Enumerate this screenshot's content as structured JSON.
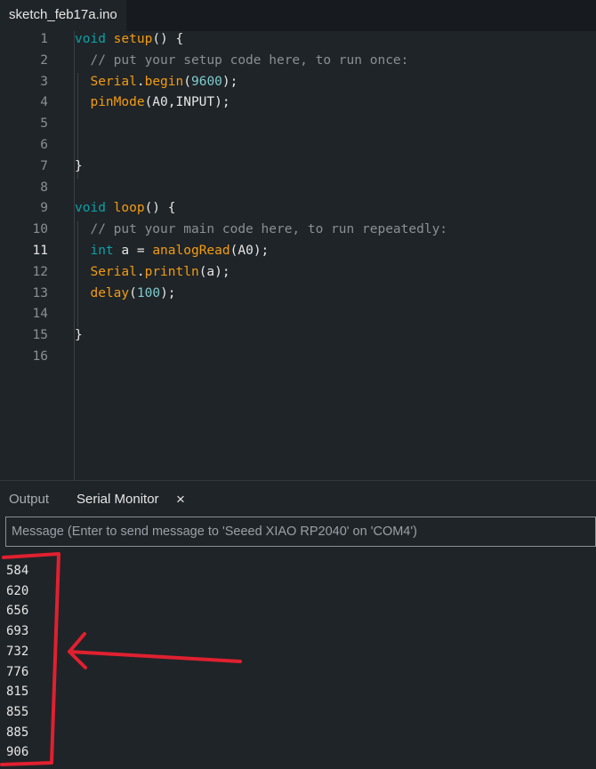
{
  "file_tab": {
    "label": "sketch_feb17a.ino"
  },
  "editor": {
    "line_numbers": [
      "1",
      "2",
      "3",
      "4",
      "5",
      "6",
      "7",
      "8",
      "9",
      "10",
      "11",
      "12",
      "13",
      "14",
      "15",
      "16"
    ],
    "lines": [
      {
        "num": "1",
        "parts": [
          {
            "t": "void",
            "c": "kw"
          },
          {
            "t": " "
          },
          {
            "t": "setup",
            "c": "fn"
          },
          {
            "t": "() {"
          }
        ]
      },
      {
        "num": "2",
        "parts": [
          {
            "t": "  // put your setup code here, to run once:",
            "c": "cm"
          }
        ]
      },
      {
        "num": "3",
        "parts": [
          {
            "t": "  "
          },
          {
            "t": "Serial",
            "c": "fn"
          },
          {
            "t": "."
          },
          {
            "t": "begin",
            "c": "fn"
          },
          {
            "t": "("
          },
          {
            "t": "9600",
            "c": "num"
          },
          {
            "t": ");"
          }
        ]
      },
      {
        "num": "4",
        "parts": [
          {
            "t": "  "
          },
          {
            "t": "pinMode",
            "c": "fn"
          },
          {
            "t": "(A0,INPUT);"
          }
        ]
      },
      {
        "num": "5",
        "parts": []
      },
      {
        "num": "6",
        "parts": []
      },
      {
        "num": "7",
        "parts": [
          {
            "t": "}"
          }
        ]
      },
      {
        "num": "8",
        "parts": []
      },
      {
        "num": "9",
        "parts": [
          {
            "t": "void",
            "c": "kw"
          },
          {
            "t": " "
          },
          {
            "t": "loop",
            "c": "fn"
          },
          {
            "t": "() {"
          }
        ]
      },
      {
        "num": "10",
        "parts": [
          {
            "t": "  // put your main code here, to run repeatedly:",
            "c": "cm"
          }
        ]
      },
      {
        "num": "11",
        "parts": [
          {
            "t": "  "
          },
          {
            "t": "int",
            "c": "kw"
          },
          {
            "t": " a = "
          },
          {
            "t": "analogRead",
            "c": "fn"
          },
          {
            "t": "(A0);"
          }
        ]
      },
      {
        "num": "12",
        "parts": [
          {
            "t": "  "
          },
          {
            "t": "Serial",
            "c": "fn"
          },
          {
            "t": "."
          },
          {
            "t": "println",
            "c": "fn"
          },
          {
            "t": "(a);"
          }
        ]
      },
      {
        "num": "13",
        "parts": [
          {
            "t": "  "
          },
          {
            "t": "delay",
            "c": "fn"
          },
          {
            "t": "("
          },
          {
            "t": "100",
            "c": "num"
          },
          {
            "t": ");"
          }
        ]
      },
      {
        "num": "14",
        "parts": []
      },
      {
        "num": "15",
        "parts": [
          {
            "t": "}"
          }
        ]
      },
      {
        "num": "16",
        "parts": []
      }
    ],
    "active_line": "11"
  },
  "panel": {
    "tab_output": "Output",
    "tab_serial": "Serial Monitor",
    "close_icon": "×",
    "message_placeholder": "Message (Enter to send message to 'Seeed XIAO RP2040' on 'COM4')"
  },
  "serial_values": [
    "584",
    "620",
    "656",
    "693",
    "732",
    "776",
    "815",
    "855",
    "885",
    "906"
  ],
  "annotation": {
    "color": "#e02030",
    "icons": [
      "highlight-box",
      "arrow-icon"
    ]
  }
}
